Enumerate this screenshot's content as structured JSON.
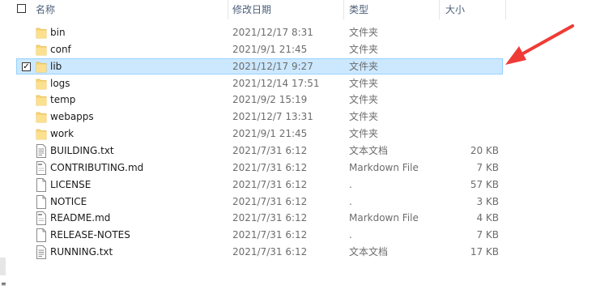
{
  "header": {
    "name": "名称",
    "modified": "修改日期",
    "type": "类型",
    "size": "大小"
  },
  "files": [
    {
      "name": "bin",
      "date": "2021/12/17 8:31",
      "type": "文件夹",
      "size": "",
      "kind": "folder-icon",
      "selected": false
    },
    {
      "name": "conf",
      "date": "2021/9/1 21:45",
      "type": "文件夹",
      "size": "",
      "kind": "folder-icon",
      "selected": false
    },
    {
      "name": "lib",
      "date": "2021/12/17 9:27",
      "type": "文件夹",
      "size": "",
      "kind": "folder-icon",
      "selected": true
    },
    {
      "name": "logs",
      "date": "2021/12/14 17:51",
      "type": "文件夹",
      "size": "",
      "kind": "folder-icon",
      "selected": false
    },
    {
      "name": "temp",
      "date": "2021/9/2 15:19",
      "type": "文件夹",
      "size": "",
      "kind": "folder-icon",
      "selected": false
    },
    {
      "name": "webapps",
      "date": "2021/12/7 13:31",
      "type": "文件夹",
      "size": "",
      "kind": "folder-icon",
      "selected": false
    },
    {
      "name": "work",
      "date": "2021/9/1 21:45",
      "type": "文件夹",
      "size": "",
      "kind": "folder-icon",
      "selected": false
    },
    {
      "name": "BUILDING.txt",
      "date": "2021/7/31 6:12",
      "type": "文本文档",
      "size": "20 KB",
      "kind": "text-file-icon",
      "selected": false
    },
    {
      "name": "CONTRIBUTING.md",
      "date": "2021/7/31 6:12",
      "type": "Markdown File",
      "size": "7 KB",
      "kind": "markdown-file-icon",
      "selected": false
    },
    {
      "name": "LICENSE",
      "date": "2021/7/31 6:12",
      "type": ".",
      "size": "57 KB",
      "kind": "blank-file-icon",
      "selected": false
    },
    {
      "name": "NOTICE",
      "date": "2021/7/31 6:12",
      "type": ".",
      "size": "3 KB",
      "kind": "blank-file-icon",
      "selected": false
    },
    {
      "name": "README.md",
      "date": "2021/7/31 6:12",
      "type": "Markdown File",
      "size": "4 KB",
      "kind": "markdown-file-icon",
      "selected": false
    },
    {
      "name": "RELEASE-NOTES",
      "date": "2021/7/31 6:12",
      "type": ".",
      "size": "7 KB",
      "kind": "blank-file-icon",
      "selected": false
    },
    {
      "name": "RUNNING.txt",
      "date": "2021/7/31 6:12",
      "type": "文本文档",
      "size": "17 KB",
      "kind": "text-file-icon",
      "selected": false
    }
  ],
  "annotation": {
    "kind": "red-arrow-icon",
    "color": "#ef3b36"
  },
  "colors": {
    "selection": "#cce8ff",
    "selection_border": "#99d1ff",
    "folder": "#f8d775",
    "folder_dark": "#e8b84a",
    "header_text": "#4c607a",
    "muted_text": "#6d6d6d"
  }
}
